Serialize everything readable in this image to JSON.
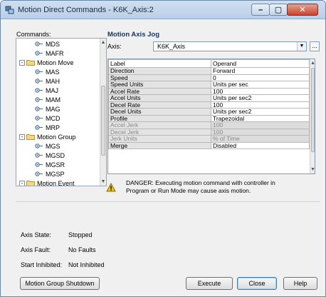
{
  "window": {
    "title": "Motion Direct Commands - K6K_Axis:2",
    "icon": "motion-command-icon",
    "minimize_glyph": "–",
    "maximize_glyph": "▢",
    "close_glyph": "✕"
  },
  "commands_label": "Commands:",
  "tree": [
    {
      "label": "MDS",
      "kind": "cmd"
    },
    {
      "label": "MAFR",
      "kind": "cmd"
    },
    {
      "label": "Motion Move",
      "kind": "group",
      "expander": "-"
    },
    {
      "label": "MAS",
      "kind": "cmd"
    },
    {
      "label": "MAH",
      "kind": "cmd"
    },
    {
      "label": "MAJ",
      "kind": "cmd"
    },
    {
      "label": "MAM",
      "kind": "cmd"
    },
    {
      "label": "MAG",
      "kind": "cmd"
    },
    {
      "label": "MCD",
      "kind": "cmd"
    },
    {
      "label": "MRP",
      "kind": "cmd"
    },
    {
      "label": "Motion Group",
      "kind": "group",
      "expander": "-"
    },
    {
      "label": "MGS",
      "kind": "cmd"
    },
    {
      "label": "MGSD",
      "kind": "cmd"
    },
    {
      "label": "MGSR",
      "kind": "cmd"
    },
    {
      "label": "MGSP",
      "kind": "cmd"
    },
    {
      "label": "Motion Event",
      "kind": "group",
      "expander": "-"
    }
  ],
  "panel_title": "Motion Axis Jog",
  "axis": {
    "label": "Axis:",
    "value": "K6K_Axis",
    "browse": "..."
  },
  "grid": {
    "headers": [
      "Label",
      "Operand"
    ],
    "rows": [
      {
        "label": "Direction",
        "operand": "Forward",
        "disabled": false
      },
      {
        "label": "Speed",
        "operand": "0",
        "disabled": false
      },
      {
        "label": "Speed Units",
        "operand": "Units per sec",
        "disabled": false
      },
      {
        "label": "Accel Rate",
        "operand": "100",
        "disabled": false
      },
      {
        "label": "Accel Units",
        "operand": "Units per sec2",
        "disabled": false
      },
      {
        "label": "Decel Rate",
        "operand": "100",
        "disabled": false
      },
      {
        "label": "Decel Units",
        "operand": "Units per sec2",
        "disabled": false
      },
      {
        "label": "Profile",
        "operand": "Trapezoidal",
        "disabled": false
      },
      {
        "label": "Accel Jerk",
        "operand": "100",
        "disabled": true
      },
      {
        "label": "Decel Jerk",
        "operand": "100",
        "disabled": true
      },
      {
        "label": "Jerk Units",
        "operand": "% of Time",
        "disabled": true
      },
      {
        "label": "Merge",
        "operand": "Disabled",
        "disabled": false
      }
    ]
  },
  "warning": {
    "icon": "warning-icon",
    "line1": "DANGER: Executing motion command with controller in",
    "line2": "Program or Run Mode may cause axis motion."
  },
  "status": {
    "axis_state_label": "Axis State:",
    "axis_state_value": "Stopped",
    "axis_fault_label": "Axis Fault:",
    "axis_fault_value": "No Faults",
    "start_inhibited_label": "Start Inhibited:",
    "start_inhibited_value": "Not Inhibited"
  },
  "buttons": {
    "shutdown": "Motion Group Shutdown",
    "execute": "Execute",
    "close": "Close",
    "help": "Help"
  },
  "colors": {
    "titlebar": "#b9cfe8",
    "panel_title": "#13335b",
    "close_button": "#c7442c",
    "warning": "#f2c500"
  }
}
